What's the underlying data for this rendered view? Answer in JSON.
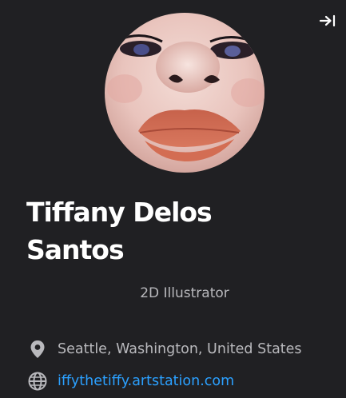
{
  "profile": {
    "name": "Tiffany Delos Santos",
    "headline": "2D Illustrator",
    "location": "Seattle, Washington, United States",
    "website": "iffythetiffy.artstation.com"
  },
  "icons": {
    "collapse": "arrow-right-to-bar-icon",
    "location": "map-pin-icon",
    "website": "globe-icon"
  },
  "colors": {
    "background": "#202023",
    "text_primary": "#ffffff",
    "text_secondary": "#b9b9bd",
    "link": "#2ba0ff"
  }
}
